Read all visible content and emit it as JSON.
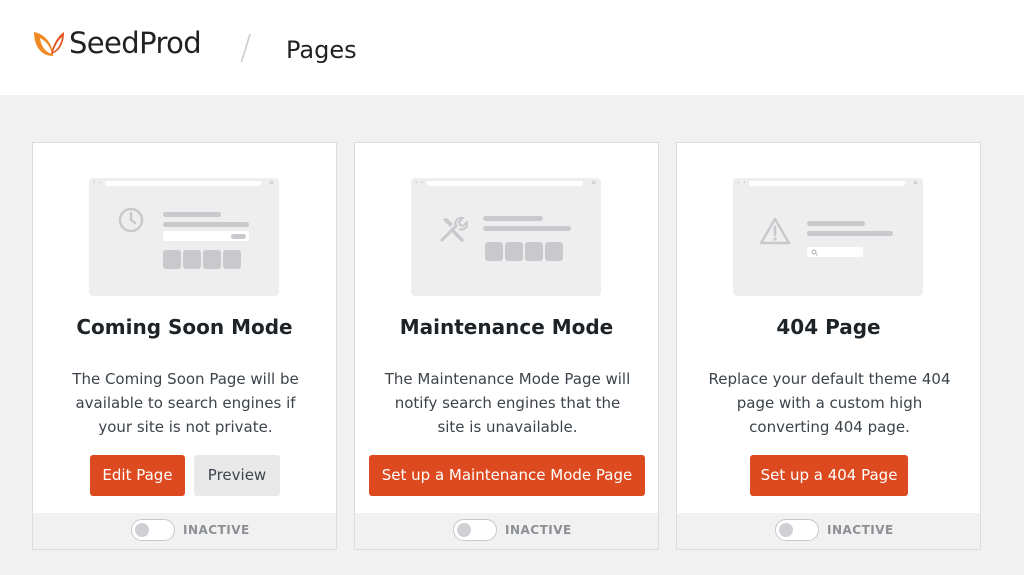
{
  "header": {
    "brand": "SeedProd",
    "separator": "/",
    "title": "Pages",
    "brand_colors": {
      "orange": "#f08a24",
      "purple": "#5b2d8e",
      "red": "#dd4a1f"
    }
  },
  "cards": [
    {
      "title": "Coming Soon Mode",
      "description": "The Coming Soon Page will be available to search engines if your site is not private.",
      "illustration_icon": "clock-icon",
      "primary_button": "Edit Page",
      "secondary_button": "Preview",
      "status": "INACTIVE"
    },
    {
      "title": "Maintenance Mode",
      "description": "The Maintenance Mode Page will notify search engines that the site is unavailable.",
      "illustration_icon": "tools-icon",
      "primary_button": "Set up a Maintenance Mode Page",
      "status": "INACTIVE"
    },
    {
      "title": "404 Page",
      "description": "Replace your default theme 404 page with a custom high converting 404 page.",
      "illustration_icon": "warning-icon",
      "primary_button": "Set up a 404 Page",
      "status": "INACTIVE"
    }
  ],
  "colors": {
    "button_primary": "#dd4a1f",
    "button_secondary": "#e9e9ea",
    "background": "#f1f1f1"
  }
}
